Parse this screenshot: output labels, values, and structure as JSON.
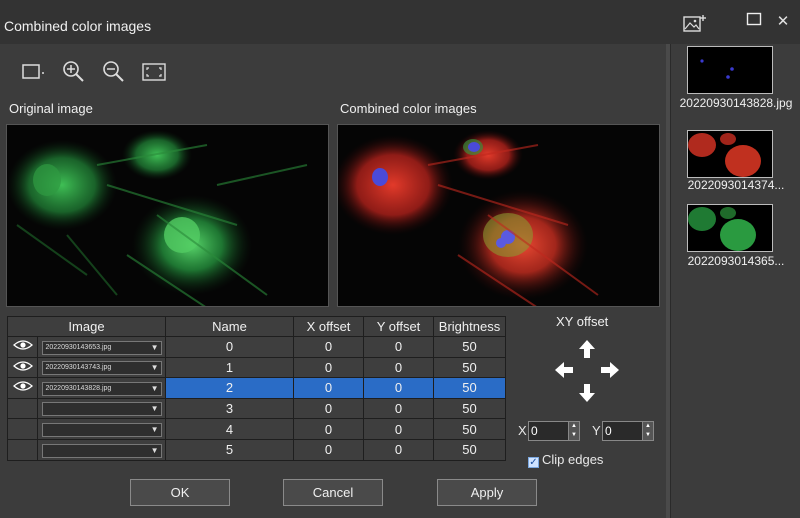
{
  "window": {
    "title": "Combined color images"
  },
  "toolbar": {
    "tools": [
      "selection-tool-icon",
      "zoom-in-icon",
      "zoom-out-icon",
      "fit-screen-icon"
    ]
  },
  "panels": {
    "original_label": "Original image",
    "combined_label": "Combined color images"
  },
  "table": {
    "headers": [
      "Image",
      "Name",
      "X offset",
      "Y offset",
      "Brightness"
    ],
    "rows": [
      {
        "file": "20220930143653.jpg",
        "name": "0",
        "x": "0",
        "y": "0",
        "brightness": "50",
        "visible": true
      },
      {
        "file": "20220930143743.jpg",
        "name": "1",
        "x": "0",
        "y": "0",
        "brightness": "50",
        "visible": true
      },
      {
        "file": "20220930143828.jpg",
        "name": "2",
        "x": "0",
        "y": "0",
        "brightness": "50",
        "visible": true,
        "selected": true
      },
      {
        "file": "",
        "name": "3",
        "x": "0",
        "y": "0",
        "brightness": "50",
        "visible": false
      },
      {
        "file": "",
        "name": "4",
        "x": "0",
        "y": "0",
        "brightness": "50",
        "visible": false
      },
      {
        "file": "",
        "name": "5",
        "x": "0",
        "y": "0",
        "brightness": "50",
        "visible": false
      }
    ]
  },
  "xy": {
    "label": "XY offset",
    "x_label": "X",
    "x_value": "0",
    "y_label": "Y",
    "y_value": "0",
    "clip_label": "Clip edges",
    "clip_checked": true
  },
  "buttons": {
    "ok": "OK",
    "cancel": "Cancel",
    "apply": "Apply"
  },
  "thumbnails": [
    {
      "label": "20220930143828.jpg"
    },
    {
      "label": "2022093014374..."
    },
    {
      "label": "2022093014365..."
    }
  ],
  "colors": {
    "selection": "#2a6cc6",
    "background": "#3c3c3c"
  }
}
